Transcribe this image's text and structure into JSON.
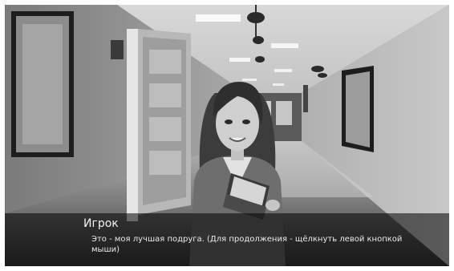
{
  "dialogue": {
    "speaker": "Игрок",
    "text": "Это - моя лучшая подруга. (Для продолжения - щёлкнуть левой кнопкой мыши)"
  },
  "scene": {
    "character": "girl-with-books",
    "background": "school-hallway",
    "tone": "grayscale"
  }
}
